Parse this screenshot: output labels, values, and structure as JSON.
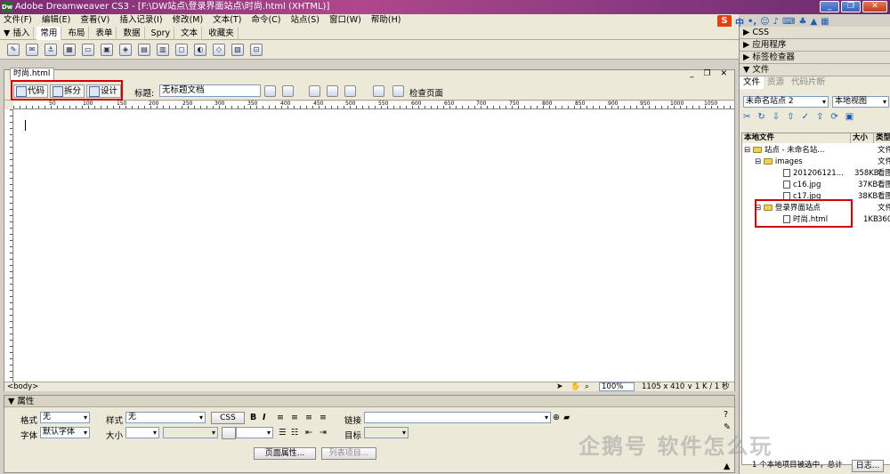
{
  "window": {
    "title": "Adobe Dreamweaver CS3 - [F:\\DW站点\\登录界面站点\\时尚.html (XHTML)]",
    "app_icon": "Dw"
  },
  "menu": [
    "文件(F)",
    "编辑(E)",
    "查看(V)",
    "插入记录(I)",
    "修改(M)",
    "文本(T)",
    "命令(C)",
    "站点(S)",
    "窗口(W)",
    "帮助(H)"
  ],
  "insert_bar": {
    "label": "▼ 插入",
    "tabs": [
      "常用",
      "布局",
      "表单",
      "数据",
      "Spry",
      "文本",
      "收藏夹"
    ]
  },
  "ime": {
    "logo": "S",
    "items": [
      "中",
      "•,",
      "☺",
      "♪"
    ]
  },
  "document": {
    "tab": "时尚.html",
    "view_buttons": [
      "代码",
      "拆分",
      "设计"
    ],
    "title_label": "标题:",
    "title_value": "无标题文档",
    "check_page": "检查页面",
    "ruler_marks": [
      "50",
      "100",
      "150",
      "200",
      "250",
      "300",
      "350",
      "400",
      "450",
      "500",
      "550",
      "600",
      "650",
      "700",
      "750",
      "800",
      "850",
      "900",
      "950",
      "1000",
      "1050"
    ],
    "status_tag": "<body>",
    "zoom": "100%",
    "dims": "1105 x 410 ∨ 1 K / 1 秒"
  },
  "properties": {
    "header": "▼ 属性",
    "format_label": "格式",
    "format_value": "无",
    "style_label": "样式",
    "style_value": "无",
    "css_button": "CSS",
    "font_label": "字体",
    "font_value": "默认字体",
    "size_label": "大小",
    "link_label": "链接",
    "target_label": "目标",
    "page_props": "页面属性...",
    "list_items": "列表项目..."
  },
  "right_panel": {
    "css": "▶ CSS",
    "app": "▶ 应用程序",
    "tag_inspector": "▶ 标签检查器",
    "files_header": "▼ 文件",
    "tabs": [
      "文件",
      "资源",
      "代码片断"
    ],
    "site_select": "未命名站点 2",
    "view_select": "本地视图",
    "columns": [
      "本地文件",
      "大小",
      "类型"
    ],
    "tree": [
      {
        "name": "站点 - 未命名站...",
        "size": "",
        "type": "文件",
        "level": 0,
        "kind": "folder"
      },
      {
        "name": "images",
        "size": "",
        "type": "文件",
        "level": 1,
        "kind": "folder"
      },
      {
        "name": "201206121...",
        "size": "358KB",
        "type": "看图",
        "level": 2,
        "kind": "file"
      },
      {
        "name": "c16.jpg",
        "size": "37KB",
        "type": "看图",
        "level": 2,
        "kind": "file"
      },
      {
        "name": "c17.jpg",
        "size": "38KB",
        "type": "看图",
        "level": 2,
        "kind": "file"
      },
      {
        "name": "登录界面站点",
        "size": "",
        "type": "文件",
        "level": 1,
        "kind": "folder"
      },
      {
        "name": "时尚.html",
        "size": "1KB",
        "type": "360",
        "level": 2,
        "kind": "file"
      }
    ],
    "status": "1 个本地项目被选中，总计",
    "log_button": "日志..."
  },
  "watermark": "企鹅号 软件怎么玩",
  "colors": {
    "highlight": "#d40000",
    "title_bar": "#9b3c8a"
  }
}
